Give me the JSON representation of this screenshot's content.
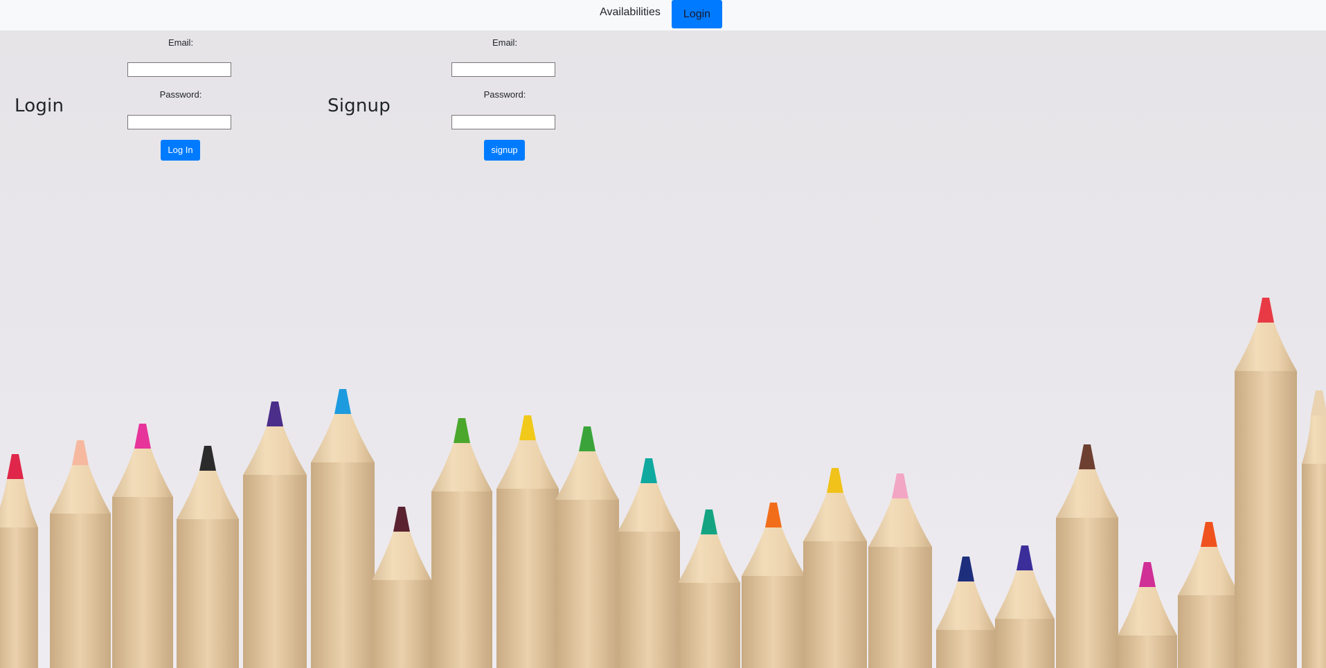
{
  "navbar": {
    "availabilities_label": "Availabilities",
    "login_label": "Login",
    "accent_color": "#007bff"
  },
  "login_form": {
    "title": "Login",
    "email_label": "Email:",
    "email_value": "",
    "password_label": "Password:",
    "password_value": "",
    "submit_label": "Log In"
  },
  "signup_form": {
    "title": "Signup",
    "email_label": "Email:",
    "email_value": "",
    "password_label": "Password:",
    "password_value": "",
    "submit_label": "signup"
  },
  "background": {
    "image": "row-of-colored-pencils"
  }
}
